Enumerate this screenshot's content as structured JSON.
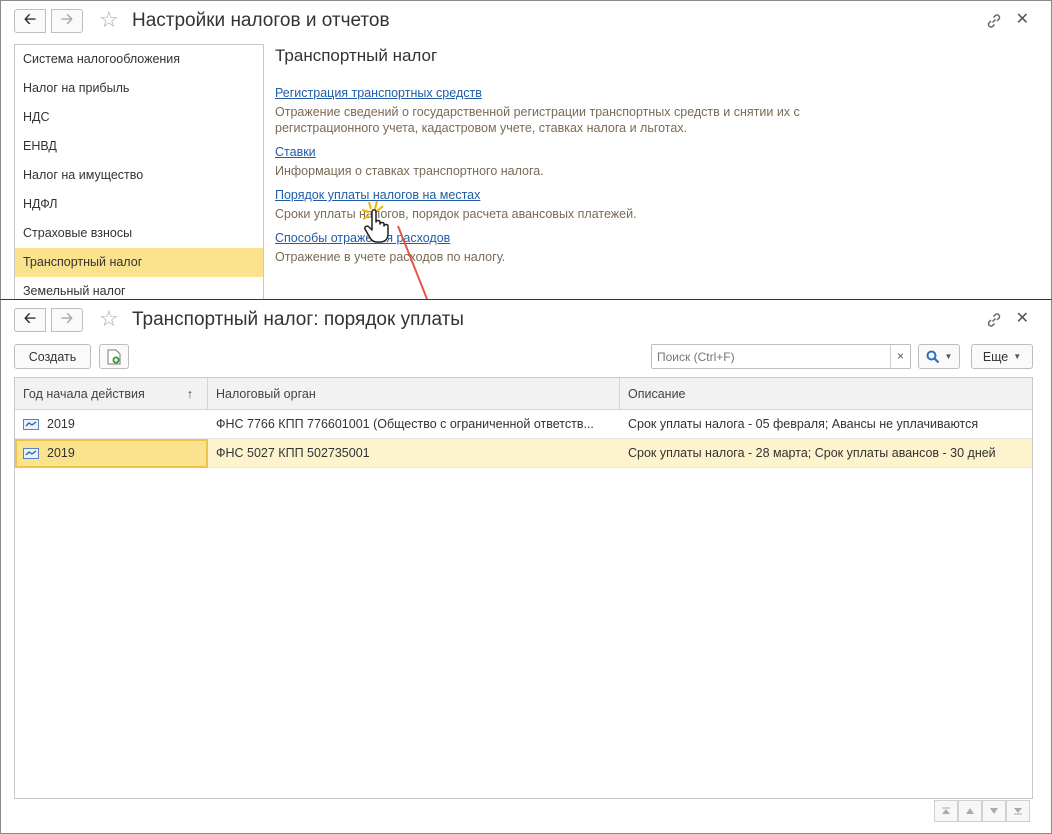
{
  "win1": {
    "title": "Настройки налогов и отчетов",
    "sidebar": [
      {
        "label": "Система налогообложения"
      },
      {
        "label": "Налог на прибыль"
      },
      {
        "label": "НДС"
      },
      {
        "label": "ЕНВД"
      },
      {
        "label": "Налог на имущество"
      },
      {
        "label": "НДФЛ"
      },
      {
        "label": "Страховые взносы"
      },
      {
        "label": "Транспортный налог"
      },
      {
        "label": "Земельный налог"
      }
    ],
    "section_title": "Транспортный налог",
    "links": [
      {
        "label": "Регистрация транспортных средств",
        "desc": "Отражение сведений о государственной регистрации транспортных средств и снятии их с",
        "desc2": "регистрационного учета, кадастровом учете, ставках налога и льготах."
      },
      {
        "label": "Ставки",
        "desc": "Информация о ставках транспортного налога."
      },
      {
        "label": "Порядок уплаты налогов на местах",
        "desc": "Сроки уплаты налогов, порядок расчета авансовых платежей."
      },
      {
        "label": "Способы отражения расходов",
        "desc": "Отражение в учете расходов по налогу."
      }
    ]
  },
  "win2": {
    "title": "Транспортный налог: порядок уплаты",
    "create_label": "Создать",
    "search_placeholder": "Поиск (Ctrl+F)",
    "clear_label": "×",
    "more_label": "Еще",
    "columns": [
      {
        "label": "Год начала действия"
      },
      {
        "label": "Налоговый орган"
      },
      {
        "label": "Описание"
      }
    ],
    "sort_indicator": "↑",
    "rows": [
      {
        "year": "2019",
        "organ": "ФНС 7766 КПП 776601001 (Общество с ограниченной ответств...",
        "desc": "Срок уплаты налога - 05 февраля; Авансы не уплачиваются"
      },
      {
        "year": "2019",
        "organ": "ФНС 5027 КПП 502735001",
        "desc": "Срок уплаты налога - 28 марта; Срок уплаты авансов -  30 дней"
      }
    ]
  },
  "colors": {
    "active_item": "#fbe38e",
    "selected_row": "#fdf3cc",
    "link": "#1f5da8",
    "desc_text": "#7a6a55",
    "annotation_line": "#e8534a"
  }
}
